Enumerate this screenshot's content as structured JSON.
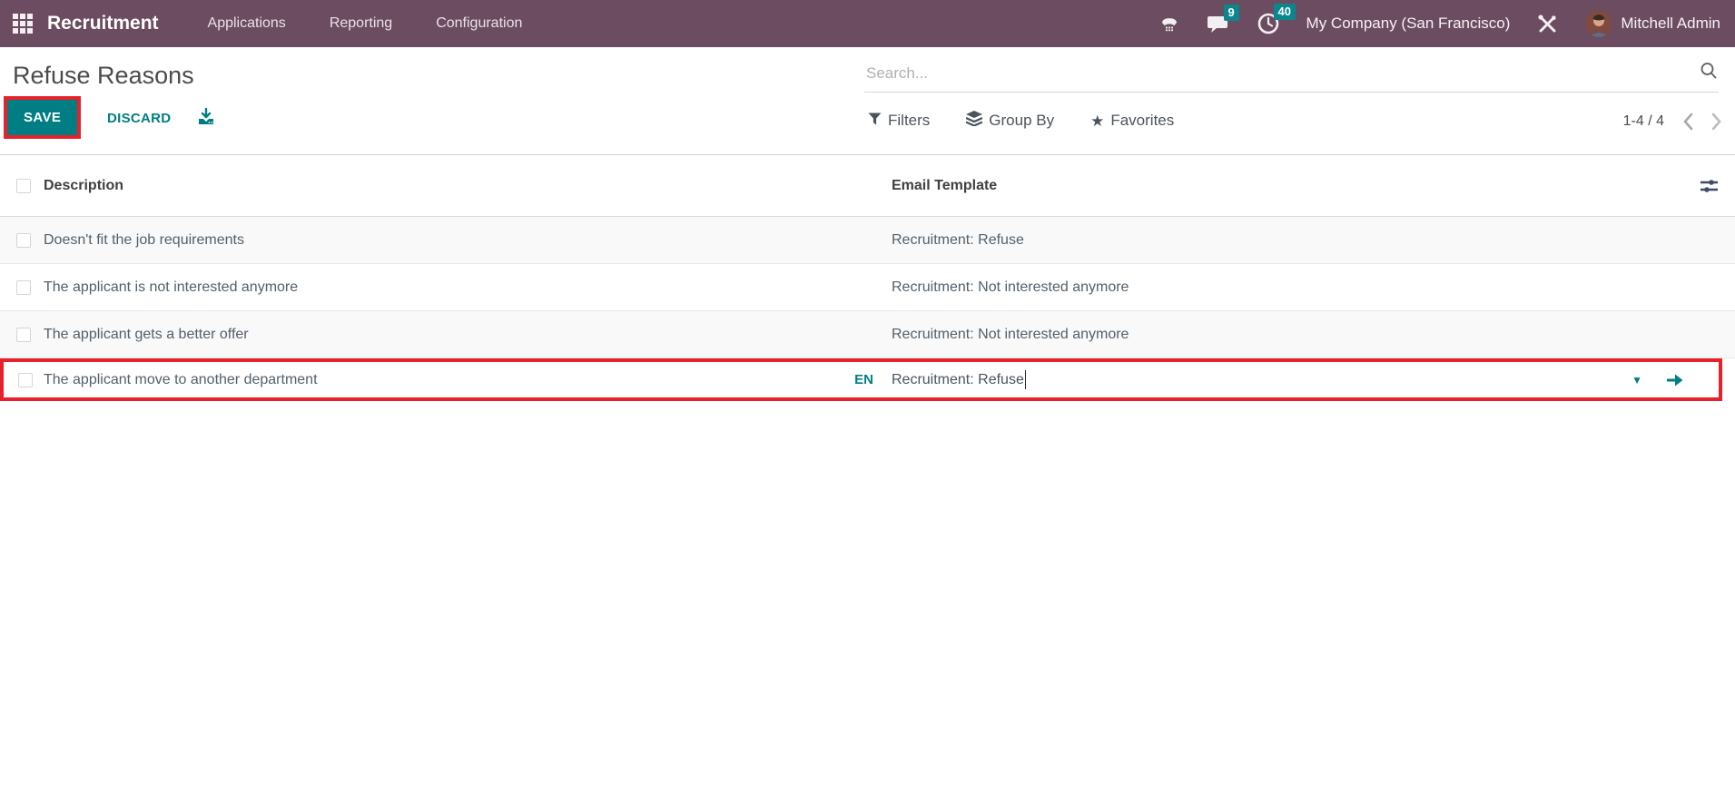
{
  "colors": {
    "topbar_bg": "#6b4c60",
    "accent_teal": "#017e84",
    "badge_teal": "#0b868d",
    "annotation_red": "#e8202a",
    "row_alt_bg": "#f9f9f9"
  },
  "topbar": {
    "brand": "Recruitment",
    "menus": [
      "Applications",
      "Reporting",
      "Configuration"
    ],
    "message_count": "9",
    "activity_count": "40",
    "company": "My Company (San Francisco)",
    "user": "Mitchell Admin"
  },
  "control": {
    "title": "Refuse Reasons",
    "save_label": "SAVE",
    "discard_label": "DISCARD",
    "search_placeholder": "Search...",
    "filters_label": "Filters",
    "group_by_label": "Group By",
    "favorites_label": "Favorites",
    "pager_text": "1-4 / 4"
  },
  "icons": {
    "star": "★",
    "caret_down": "▼"
  },
  "table": {
    "headers": {
      "description": "Description",
      "email_template": "Email Template"
    },
    "rows": [
      {
        "description": "Doesn't fit the job requirements",
        "email_template": "Recruitment: Refuse"
      },
      {
        "description": "The applicant is not interested anymore",
        "email_template": "Recruitment: Not interested anymore"
      },
      {
        "description": "The applicant gets a better offer",
        "email_template": "Recruitment: Not interested anymore"
      },
      {
        "description": "The applicant move to another department",
        "email_template": "Recruitment: Refuse",
        "lang_badge": "EN"
      }
    ]
  }
}
